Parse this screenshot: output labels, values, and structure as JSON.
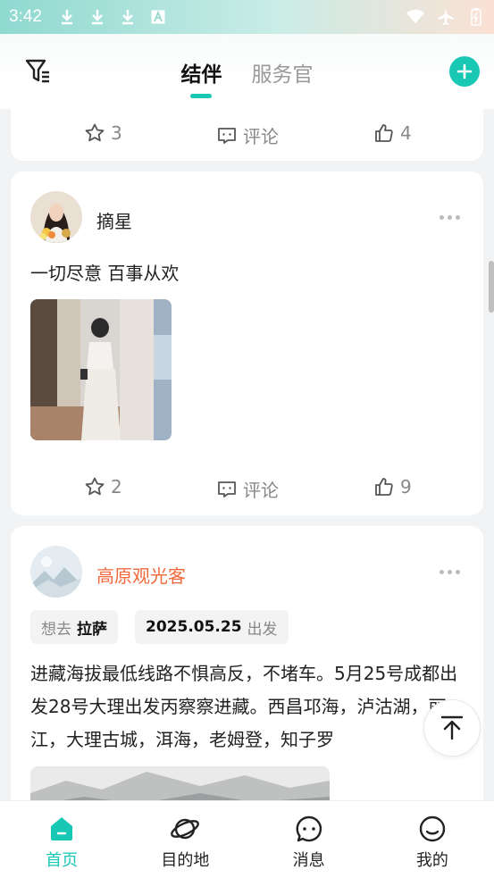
{
  "status_bar": {
    "time": "3:42",
    "icons": [
      "download-icon",
      "download-icon",
      "download-icon",
      "text-a-icon",
      "wifi-icon",
      "airplane-icon",
      "battery-icon"
    ]
  },
  "header": {
    "tabs": [
      {
        "label": "结伴",
        "active": true
      },
      {
        "label": "服务官",
        "active": false
      }
    ]
  },
  "posts": [
    {
      "stars": "3",
      "comment_label": "评论",
      "likes": "4"
    },
    {
      "author": "摘星",
      "text": "一切尽意 百事从欢",
      "stars": "2",
      "comment_label": "评论",
      "likes": "9"
    },
    {
      "author": "高原观光客",
      "author_color": "#f2683a",
      "tag_want_prefix": "想去",
      "tag_want_place": "拉萨",
      "tag_date": "2025.05.25",
      "tag_date_suffix": "出发",
      "text": "进藏海拔最低线路不惧高反，不堵车。5月25号成都出发28号大理出发丙察察进藏。西昌邛海，泸沽湖，丽江，大理古城，洱海，老姆登，知子罗"
    }
  ],
  "accent_color": "#19c7b5",
  "bottom_nav": [
    {
      "label": "首页",
      "icon": "home-icon",
      "active": true
    },
    {
      "label": "目的地",
      "icon": "planet-icon",
      "active": false
    },
    {
      "label": "消息",
      "icon": "message-icon",
      "active": false
    },
    {
      "label": "我的",
      "icon": "smile-icon",
      "active": false
    }
  ]
}
